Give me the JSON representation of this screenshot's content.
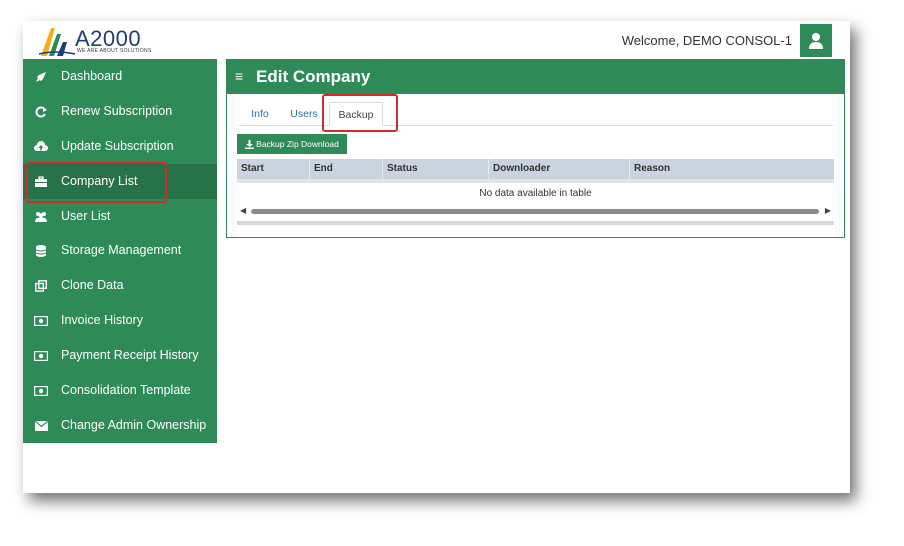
{
  "brand": {
    "name": "A2000",
    "tagline": "WE ARE ABOUT SOLUTIONS"
  },
  "header": {
    "welcome": "Welcome, DEMO CONSOL-1",
    "avatar_icon": "user-icon"
  },
  "sidebar": {
    "items": [
      {
        "label": "Dashboard",
        "icon": "rocket-icon"
      },
      {
        "label": "Renew Subscription",
        "icon": "refresh-icon"
      },
      {
        "label": "Update Subscription",
        "icon": "cloud-upload-icon"
      },
      {
        "label": "Company List",
        "icon": "briefcase-icon",
        "active": true
      },
      {
        "label": "User List",
        "icon": "users-icon"
      },
      {
        "label": "Storage Management",
        "icon": "database-icon"
      },
      {
        "label": "Clone Data",
        "icon": "clone-icon"
      },
      {
        "label": "Invoice History",
        "icon": "money-icon"
      },
      {
        "label": "Payment Receipt History",
        "icon": "money-icon"
      },
      {
        "label": "Consolidation Template",
        "icon": "money-icon"
      },
      {
        "label": "Change Admin Ownership",
        "icon": "envelope-icon"
      }
    ]
  },
  "panel": {
    "title": "Edit Company",
    "menu_icon": "hamburger-icon",
    "tabs": [
      {
        "label": "Info"
      },
      {
        "label": "Users"
      },
      {
        "label": "Backup",
        "active": true
      }
    ],
    "backup_button": "Backup Zip Download",
    "table": {
      "columns": [
        "Start",
        "End",
        "Status",
        "Downloader",
        "Reason"
      ],
      "empty_message": "No data available in table"
    }
  },
  "colors": {
    "primary": "#2e8b57",
    "active": "#267349",
    "highlight": "#d42a2a",
    "table_header": "#c9d4df"
  }
}
